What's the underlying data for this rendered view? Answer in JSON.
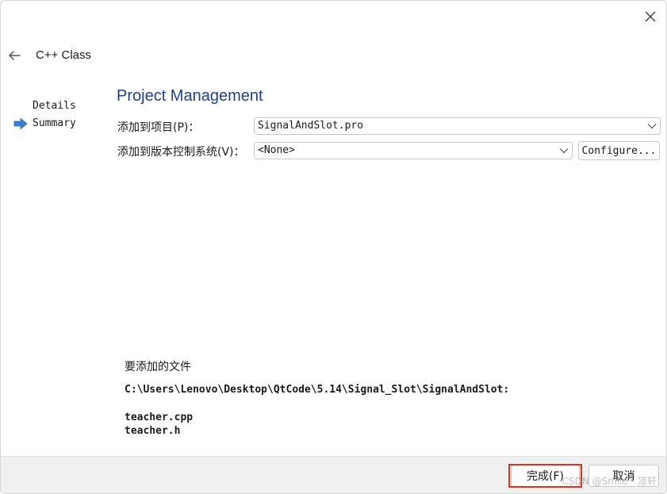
{
  "window": {
    "title": "C++ Class"
  },
  "steps": [
    {
      "label": "Details",
      "current": false
    },
    {
      "label": "Summary",
      "current": true
    }
  ],
  "page": {
    "heading": "Project Management",
    "add_to_project_label": "添加到项目(P)：",
    "add_to_project_value": "SignalAndSlot.pro",
    "vcs_label": "添加到版本控制系统(V)：",
    "vcs_value": "<None>",
    "configure_label": "Configure..."
  },
  "files": {
    "heading": "要添加的文件",
    "path": "C:\\Users\\Lenovo\\Desktop\\QtCode\\5.14\\Signal_Slot\\SignalAndSlot:",
    "items": [
      "teacher.cpp",
      "teacher.h"
    ]
  },
  "footer": {
    "finish_label": "完成(F)",
    "cancel_label": "取消",
    "watermark": "CSDN @Smile - 凉轩"
  },
  "colors": {
    "heading": "#1c3f94",
    "highlight": "#e53020",
    "arrow": "#3b7fd4"
  }
}
